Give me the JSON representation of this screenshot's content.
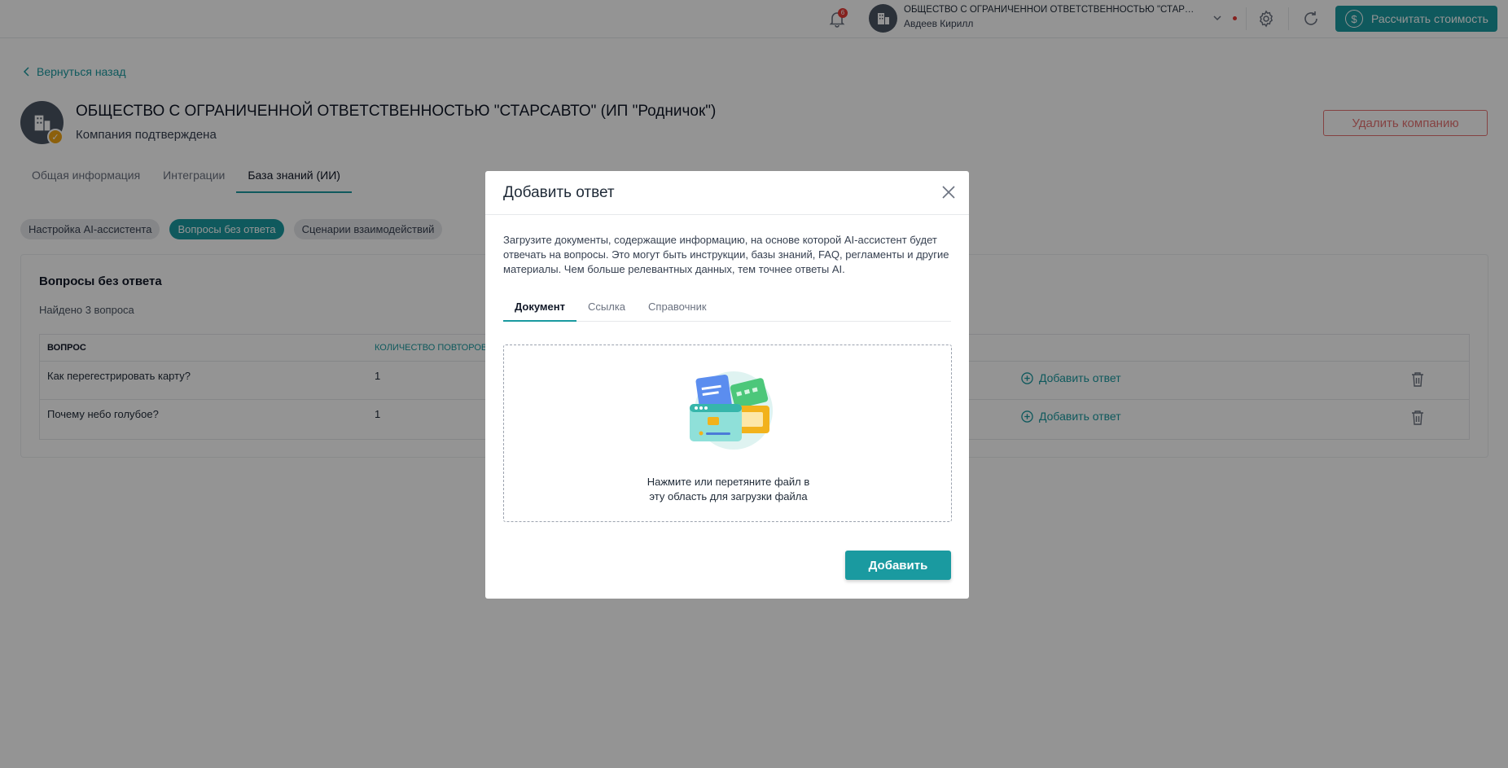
{
  "topbar": {
    "notification_count": "6",
    "company_name": "ОБЩЕСТВО С ОГРАНИЧЕННОЙ ОТВЕТСТВЕННОСТЬЮ \"СТАРСАВТО\"...",
    "user_name": "Авдеев Кирилл",
    "calc_button": "Рассчитать стоимость"
  },
  "page": {
    "back_link": "Вернуться назад",
    "title": "ОБЩЕСТВО С ОГРАНИЧЕННОЙ ОТВЕТСТВЕННОСТЬЮ \"СТАРСАВТО\" (ИП \"Родничок\")",
    "subtitle": "Компания подтверждена",
    "delete_button": "Удалить компанию",
    "tabs": [
      "Общая информация",
      "Интеграции",
      "База знаний (ИИ)"
    ],
    "chips": [
      "Настройка AI-ассистента",
      "Вопросы без ответа",
      "Сценарии взаимодействий"
    ]
  },
  "panel": {
    "title": "Вопросы без ответа",
    "count": "Найдено 3 вопроса",
    "columns": [
      "ВОПРОС",
      "КОЛИЧЕСТВО ПОВТОРОВ"
    ],
    "rows": [
      {
        "question": "Как перегестрировать карту?",
        "count": "1",
        "action": "Добавить ответ"
      },
      {
        "question": "Почему небо голубое?",
        "count": "1",
        "action": "Добавить ответ"
      }
    ]
  },
  "modal": {
    "title": "Добавить ответ",
    "description": "Загрузите документы, содержащие информацию, на основе которой AI-ассистент будет отвечать на вопросы. Это могут быть инструкции, базы знаний, FAQ, регламенты и другие материалы. Чем больше релевантных данных, тем точнее ответы AI.",
    "tabs": [
      "Документ",
      "Ссылка",
      "Справочник"
    ],
    "dropzone_line1": "Нажмите или перетяните файл в",
    "dropzone_line2": "эту область для загрузки файла",
    "submit": "Добавить"
  },
  "colors": {
    "accent": "#1a9aa0",
    "danger": "#e57373",
    "badge": "#e53935",
    "verified": "#f2a516"
  }
}
